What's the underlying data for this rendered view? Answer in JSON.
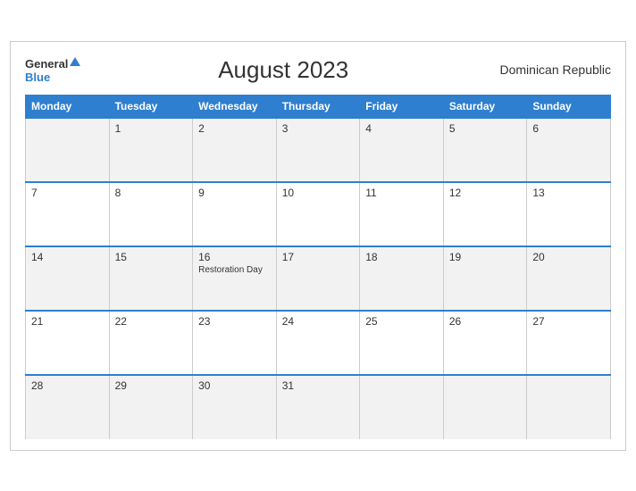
{
  "header": {
    "logo_general": "General",
    "logo_blue": "Blue",
    "title": "August 2023",
    "region": "Dominican Republic"
  },
  "weekdays": [
    "Monday",
    "Tuesday",
    "Wednesday",
    "Thursday",
    "Friday",
    "Saturday",
    "Sunday"
  ],
  "weeks": [
    [
      {
        "day": "",
        "event": ""
      },
      {
        "day": "1",
        "event": ""
      },
      {
        "day": "2",
        "event": ""
      },
      {
        "day": "3",
        "event": ""
      },
      {
        "day": "4",
        "event": ""
      },
      {
        "day": "5",
        "event": ""
      },
      {
        "day": "6",
        "event": ""
      }
    ],
    [
      {
        "day": "7",
        "event": ""
      },
      {
        "day": "8",
        "event": ""
      },
      {
        "day": "9",
        "event": ""
      },
      {
        "day": "10",
        "event": ""
      },
      {
        "day": "11",
        "event": ""
      },
      {
        "day": "12",
        "event": ""
      },
      {
        "day": "13",
        "event": ""
      }
    ],
    [
      {
        "day": "14",
        "event": ""
      },
      {
        "day": "15",
        "event": ""
      },
      {
        "day": "16",
        "event": "Restoration Day"
      },
      {
        "day": "17",
        "event": ""
      },
      {
        "day": "18",
        "event": ""
      },
      {
        "day": "19",
        "event": ""
      },
      {
        "day": "20",
        "event": ""
      }
    ],
    [
      {
        "day": "21",
        "event": ""
      },
      {
        "day": "22",
        "event": ""
      },
      {
        "day": "23",
        "event": ""
      },
      {
        "day": "24",
        "event": ""
      },
      {
        "day": "25",
        "event": ""
      },
      {
        "day": "26",
        "event": ""
      },
      {
        "day": "27",
        "event": ""
      }
    ],
    [
      {
        "day": "28",
        "event": ""
      },
      {
        "day": "29",
        "event": ""
      },
      {
        "day": "30",
        "event": ""
      },
      {
        "day": "31",
        "event": ""
      },
      {
        "day": "",
        "event": ""
      },
      {
        "day": "",
        "event": ""
      },
      {
        "day": "",
        "event": ""
      }
    ]
  ]
}
